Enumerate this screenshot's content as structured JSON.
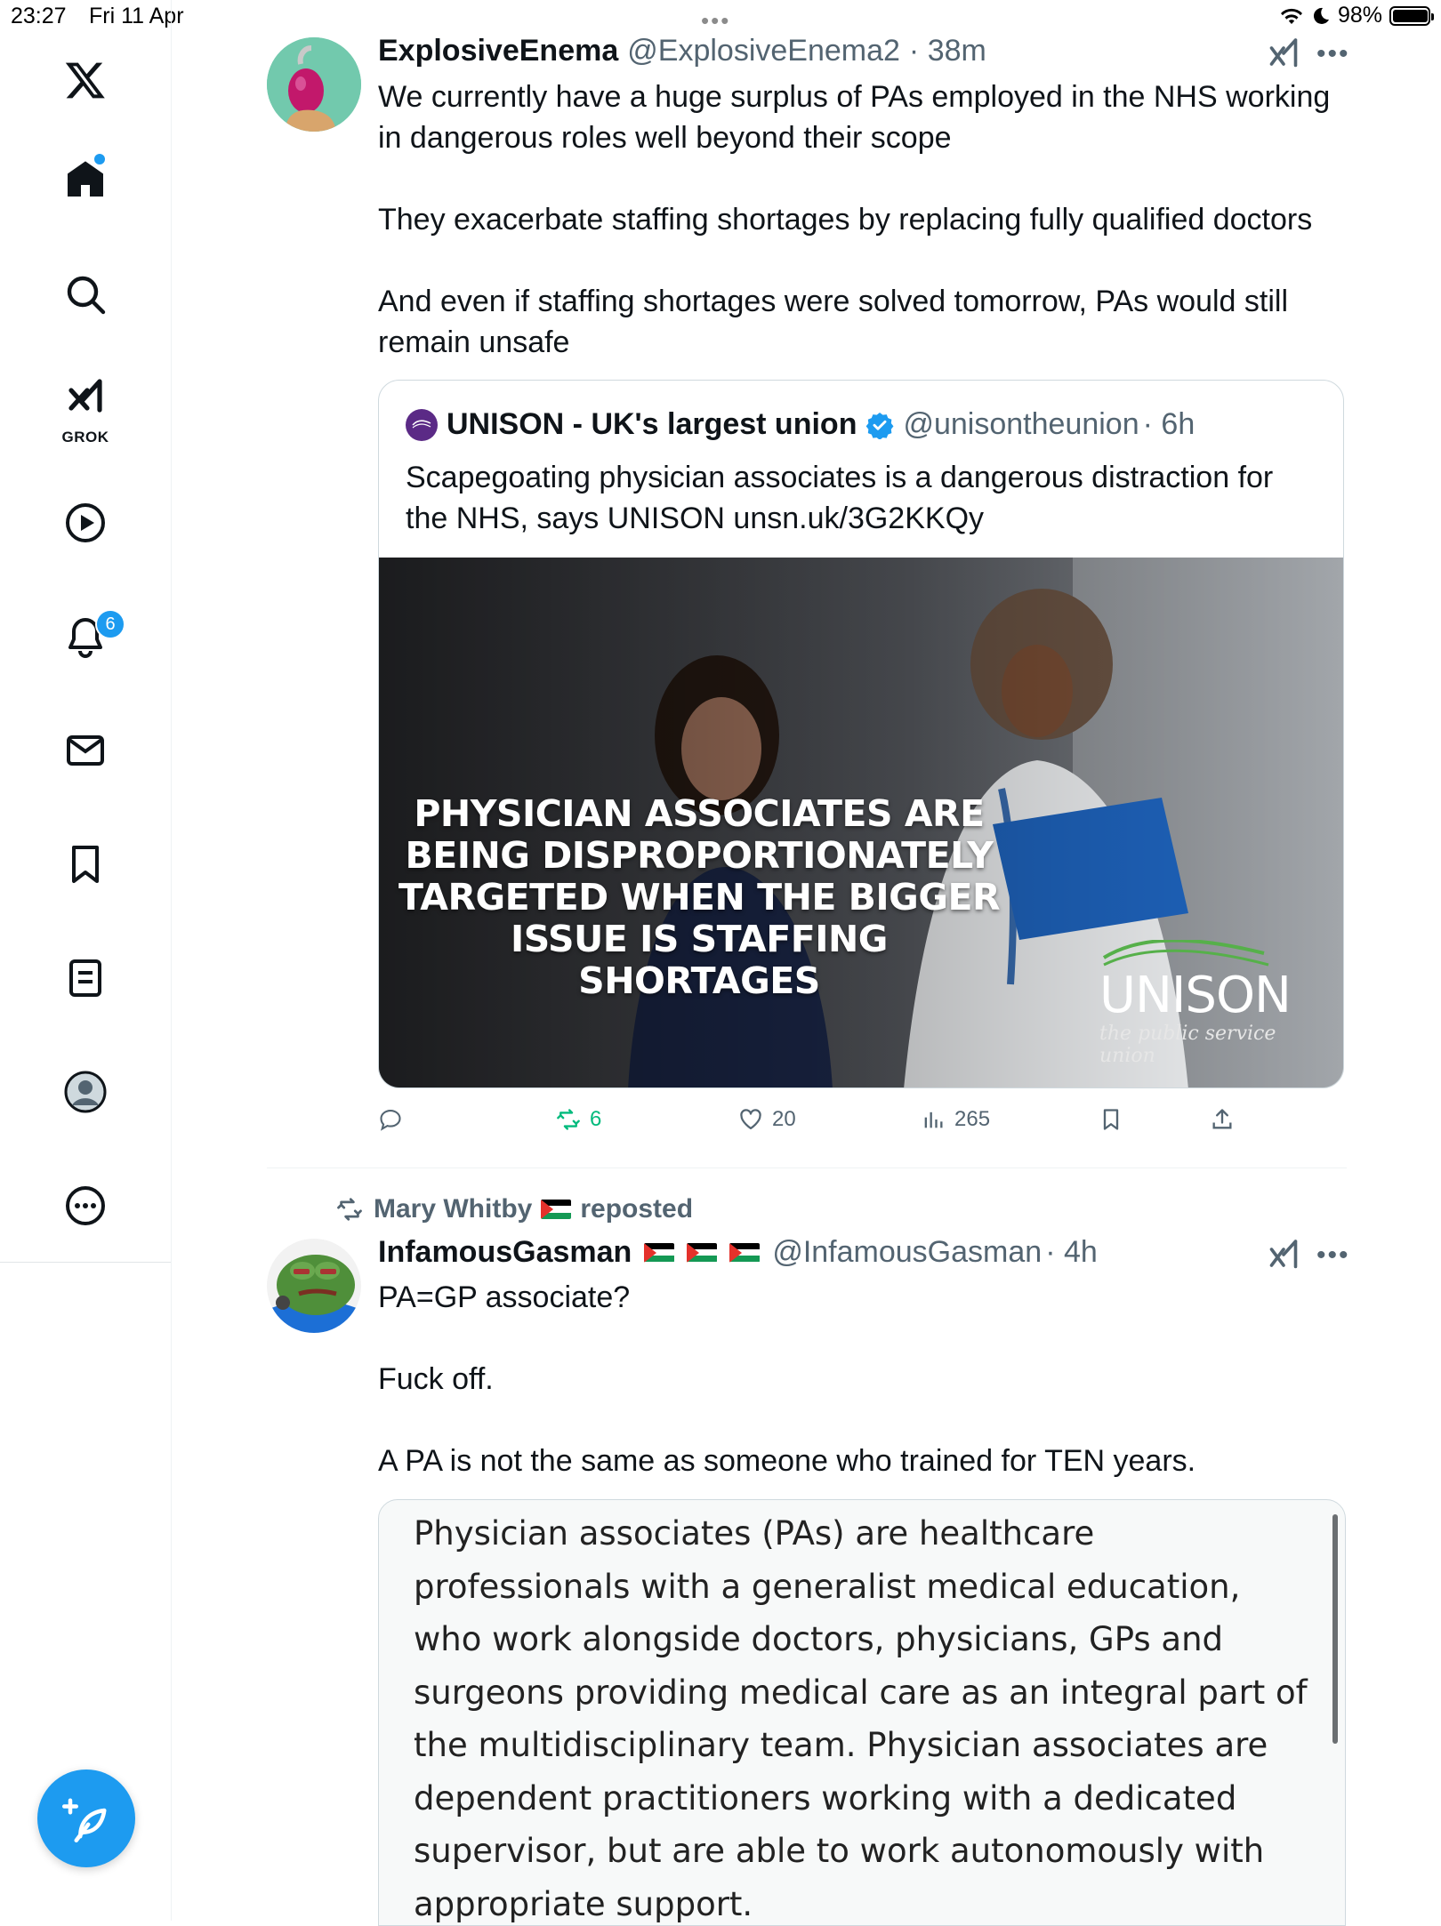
{
  "status_bar": {
    "time": "23:27",
    "date": "Fri 11 Apr",
    "battery": "98%",
    "battery_level": 0.98
  },
  "sidebar": {
    "notifications_badge": "6",
    "grok_label": "GROK",
    "items": [
      "x-logo",
      "home",
      "explore",
      "grok",
      "video",
      "notifications",
      "messages",
      "bookmarks",
      "lists",
      "profile",
      "more"
    ]
  },
  "tweet1": {
    "display_name": "ExplosiveEnema",
    "handle": "@ExplosiveEnema2",
    "time": "· 38m",
    "text": "We currently have a huge surplus of PAs employed in the NHS working in dangerous roles well beyond their scope\n\nThey exacerbate staffing shortages by replacing fully qualified doctors\n\nAnd even if staffing shortages were solved tomorrow, PAs would still remain unsafe",
    "quote": {
      "display_name": "UNISON - UK's largest union",
      "handle": "@unisontheunion",
      "time": "· 6h",
      "text": "Scapegoating physician associates is a dangerous distraction for the NHS, says UNISON unsn.uk/3G2KKQy",
      "image_overlay": "PHYSICIAN ASSOCIATES ARE BEING DISPROPORTIONATELY TARGETED WHEN THE BIGGER ISSUE IS STAFFING SHORTAGES",
      "logo_text": "UNISON",
      "logo_tagline": "the public service union"
    },
    "actions": {
      "replies": "",
      "reposts": "6",
      "likes": "20",
      "views": "265"
    }
  },
  "repost_banner": {
    "user": "Mary Whitby",
    "label": "reposted"
  },
  "tweet2": {
    "display_name": "InfamousGasman",
    "handle": "@InfamousGasman",
    "time": "· 4h",
    "text": "PA=GP associate?\n\nFuck off.\n\nA PA is not the same as someone who trained for TEN years.",
    "embedded_text": "Physician associates (PAs) are healthcare professionals with a generalist medical education, who work alongside doctors, physicians, GPs and surgeons providing medical care as an integral part of the multidisciplinary team. Physician associates are dependent practitioners working with a dedicated supervisor, but are able to work autonomously with appropriate support."
  },
  "colors": {
    "accent": "#1d9bf0",
    "repost_green": "#00ba7c",
    "text": "#0f1419",
    "secondary": "#536471"
  }
}
